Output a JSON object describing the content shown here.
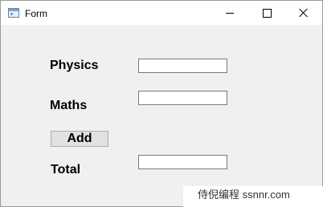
{
  "window": {
    "title": "Form",
    "icon": "form-app-icon",
    "controls": {
      "minimize_icon": "minimize-icon",
      "maximize_icon": "maximize-icon",
      "close_icon": "close-icon"
    }
  },
  "form": {
    "physics_label": "Physics",
    "physics_value": "",
    "maths_label": "Maths",
    "maths_value": "",
    "add_button_label": "Add",
    "total_label": "Total",
    "total_value": ""
  },
  "watermark": {
    "text": "侍倪编程 ssnnr.com"
  },
  "colors": {
    "form_background": "#f0f0f0",
    "titlebar_background": "#ffffff",
    "button_background": "#e1e1e1",
    "field_border": "#7a7a7a"
  }
}
